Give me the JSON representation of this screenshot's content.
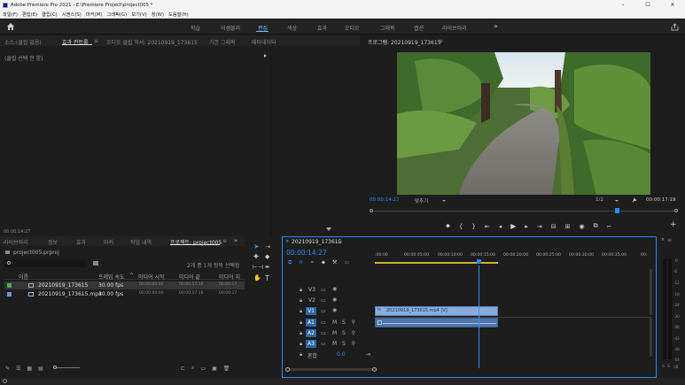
{
  "titlebar": {
    "title": "Adobe Premiere Pro 2021 - E:\\Premiere Project\\project005 *",
    "minimize": "–",
    "maximize": "☐",
    "close": "✕"
  },
  "menubar": [
    "파일(F)",
    "편집(E)",
    "클립(C)",
    "시퀀스(S)",
    "마커(M)",
    "그래픽(G)",
    "보기(V)",
    "창(W)",
    "도움말(H)"
  ],
  "workspaces": [
    "학습",
    "어셈블리",
    "편집",
    "색상",
    "효과",
    "오디오",
    "그래픽",
    "캡션",
    "라이브러리"
  ],
  "workspaces_more": "»",
  "source_panel": {
    "tabs": [
      "소스:(클립 없음)",
      "효과 컨트롤",
      "오디오 클립 믹서: 20210919_173615",
      "기본 그래픽",
      "메타데이터"
    ],
    "menu_glyph": "≡",
    "no_clip_text": "(클립 선택 안 함)",
    "timecode": "00:00:14:27"
  },
  "program_monitor": {
    "title": "프로그램: 20210919_173615",
    "menu_glyph": "≡",
    "timecode": "00:00:14:27",
    "fit": "맞추기",
    "resolution": "1/2",
    "duration": "00:00:17:19",
    "playhead_fraction": 0.8
  },
  "project_panel": {
    "tabs": [
      "라이브러리",
      "정보",
      "효과",
      "마커",
      "작업 내역",
      "프로젝트: project005"
    ],
    "more": "»",
    "file": "project005.prproj",
    "selection_info": "2개 중 1개 항목 선택함",
    "columns": [
      "이름",
      "프레임 속도",
      "미디어 시작",
      "미디어 끝",
      "미디어 지"
    ],
    "rows": [
      {
        "name": "20210919_173615",
        "fps": "30.00 fps",
        "start": "00:00:00:00",
        "end": "00:00:17:18",
        "dur": "00:00:17",
        "type": "sequence",
        "color": "#4caf50"
      },
      {
        "name": "20210919_173615.mp4",
        "fps": "30.00 fps",
        "start": "00:00:00:00",
        "end": "00:00:17:18",
        "dur": "00:00:17",
        "type": "video",
        "color": "#5b9bd5"
      }
    ]
  },
  "timeline": {
    "title": "20210919_173615",
    "menu_glyph": "≡",
    "timecode": "00:00:14:27",
    "ruler": [
      ":00:00",
      "00:00:05:00",
      "00:00:10:00",
      "00:00:15:00",
      "00:00:20:00",
      "00:00:25:00",
      "00:00:30:00",
      "00:00:35:00",
      "00:"
    ],
    "video_tracks": [
      "V3",
      "V2",
      "V1"
    ],
    "audio_tracks": [
      "A1",
      "A2",
      "A3"
    ],
    "audio_btns": [
      "M",
      "S"
    ],
    "mix_label": "혼합",
    "mix_value": "0.0",
    "clip_label": "20210919_173615.mp4 [V]",
    "clip_fx": "fx"
  },
  "meter": {
    "scale": [
      "0",
      "-6",
      "-12",
      "-18",
      "-24",
      "-30",
      "-36",
      "-42",
      "-48",
      "-54"
    ],
    "db": "dB",
    "solo": [
      "S",
      "S"
    ]
  },
  "colors": {
    "accent": "#2d8ceb",
    "video_clip": "#8aacdc",
    "audio_clip": "#4f76ab",
    "sequence": "#4caf50",
    "playhead": "#3b8fe6",
    "active_track": "#2a6aa8"
  }
}
